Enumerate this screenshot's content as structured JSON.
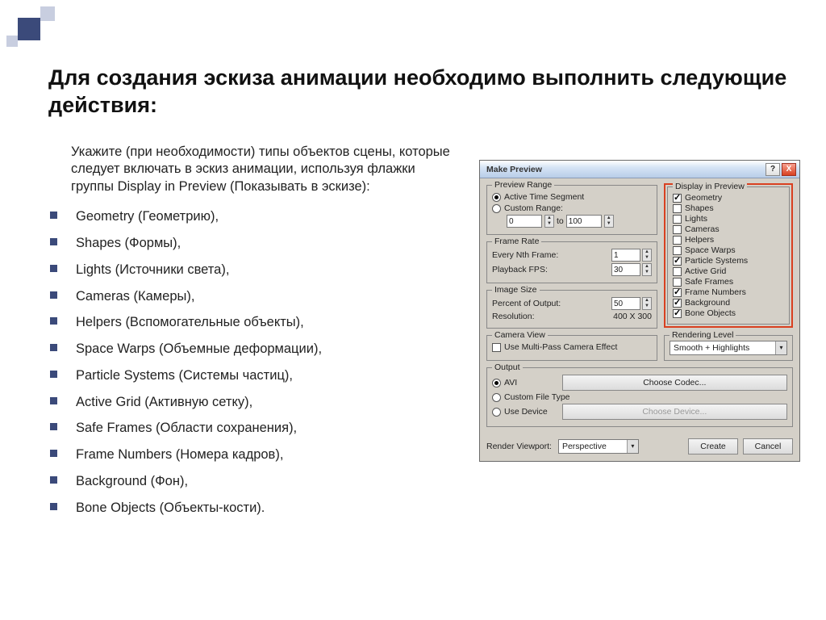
{
  "title": "Для создания эскиза анимации необходимо выполнить следующие действия:",
  "intro": "Укажите (при необходимости) типы объектов сцены, которые следует включать в эскиз анимации, используя флажки группы Display in Preview (Показывать в эскизе):",
  "bullets": [
    "Geometry (Геометрию),",
    " Shapes (Формы),",
    "Lights (Источники света),",
    "Cameras (Камеры),",
    " Helpers (Вспомогательные объекты),",
    "Space Warps (Объемные деформации),",
    " Particle Systems (Системы частиц),",
    "Active Grid (Активную сетку),",
    "Safe Frames (Области сохранения),",
    "Frame Numbers (Номера кадров),",
    " Background (Фон),",
    "Bone Objects (Объекты-кости)."
  ],
  "dialog": {
    "title": "Make Preview",
    "preview_range": {
      "legend": "Preview Range",
      "active": "Active Time Segment",
      "custom": "Custom Range:",
      "from": "0",
      "to_label": "to",
      "to": "100"
    },
    "frame_rate": {
      "legend": "Frame Rate",
      "nth_label": "Every Nth Frame:",
      "nth": "1",
      "fps_label": "Playback FPS:",
      "fps": "30"
    },
    "image_size": {
      "legend": "Image Size",
      "percent_label": "Percent of Output:",
      "percent": "50",
      "res_label": "Resolution:",
      "res": "400  X  300"
    },
    "display": {
      "legend": "Display in Preview",
      "items": [
        {
          "label": "Geometry",
          "checked": true
        },
        {
          "label": "Shapes",
          "checked": false
        },
        {
          "label": "Lights",
          "checked": false
        },
        {
          "label": "Cameras",
          "checked": false
        },
        {
          "label": "Helpers",
          "checked": false
        },
        {
          "label": "Space Warps",
          "checked": false
        },
        {
          "label": "Particle Systems",
          "checked": true
        },
        {
          "label": "Active Grid",
          "checked": false
        },
        {
          "label": "Safe Frames",
          "checked": false
        },
        {
          "label": "Frame Numbers",
          "checked": true
        },
        {
          "label": "Background",
          "checked": true
        },
        {
          "label": "Bone Objects",
          "checked": true
        }
      ]
    },
    "camera_view": {
      "legend": "Camera View",
      "multipass": "Use Multi-Pass Camera Effect"
    },
    "rendering_level": {
      "legend": "Rendering Level",
      "value": "Smooth + Highlights"
    },
    "output": {
      "legend": "Output",
      "avi": "AVI",
      "codec_btn": "Choose Codec...",
      "custom": "Custom File Type",
      "device": "Use Device",
      "device_btn": "Choose Device..."
    },
    "footer": {
      "render_viewport_label": "Render Viewport:",
      "render_viewport": "Perspective",
      "create": "Create",
      "cancel": "Cancel"
    }
  }
}
